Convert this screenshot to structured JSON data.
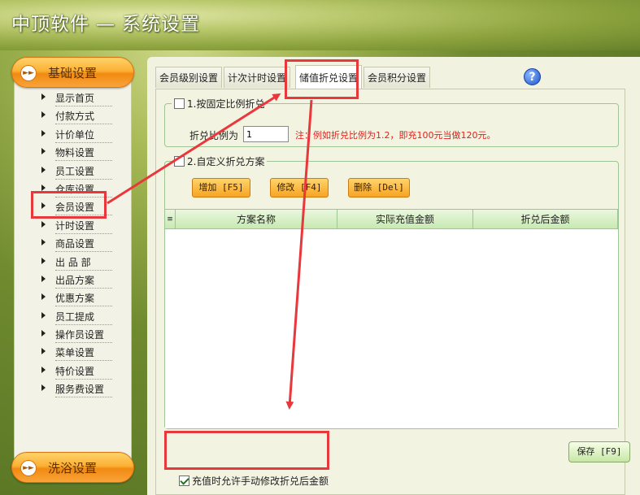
{
  "app": {
    "title": "中顶软件",
    "separator": "—",
    "subtitle": "系统设置"
  },
  "sidebar": {
    "top_category": {
      "label": "基础设置",
      "icon": "double-arrow-icon"
    },
    "bottom_category": {
      "label": "洗浴设置",
      "icon": "double-arrow-icon"
    },
    "items": [
      {
        "label": "显示首页"
      },
      {
        "label": "付款方式"
      },
      {
        "label": "计价单位"
      },
      {
        "label": "物料设置"
      },
      {
        "label": "员工设置"
      },
      {
        "label": "仓库设置"
      },
      {
        "label": "会员设置",
        "selected": true
      },
      {
        "label": "计时设置"
      },
      {
        "label": "商品设置"
      },
      {
        "label": "出 品 部"
      },
      {
        "label": "出品方案"
      },
      {
        "label": "优惠方案"
      },
      {
        "label": "员工提成"
      },
      {
        "label": "操作员设置"
      },
      {
        "label": "菜单设置"
      },
      {
        "label": "特价设置"
      },
      {
        "label": "服务费设置"
      }
    ]
  },
  "tabs": [
    {
      "label": "会员级别设置"
    },
    {
      "label": "计次计时设置"
    },
    {
      "label": "储值折兑设置",
      "active": true
    },
    {
      "label": "会员积分设置"
    }
  ],
  "help_icon": "?",
  "fixed_ratio": {
    "checkbox_label": "1.按固定比例折兑",
    "checked": false,
    "rate_label": "折兑比例为",
    "rate_value": "1",
    "note": "注：例如折兑比例为1.2，即充100元当做120元。"
  },
  "custom_plan": {
    "checkbox_label": "2.自定义折兑方案",
    "checked": false,
    "buttons": {
      "add": "增加 [F5]",
      "edit": "修改 [F4]",
      "delete": "删除 [Del]"
    },
    "table": {
      "columns": [
        "方案名称",
        "实际充值金额",
        "折兑后金额"
      ],
      "rows": []
    }
  },
  "allow_manual": {
    "label": "充值时允许手动修改折兑后金额",
    "checked": true
  },
  "save_button": "保存 [F9]",
  "colors": {
    "highlight": "#e8383b",
    "accent_orange": "#f7a423",
    "grid_header": "#c8e9b2"
  }
}
